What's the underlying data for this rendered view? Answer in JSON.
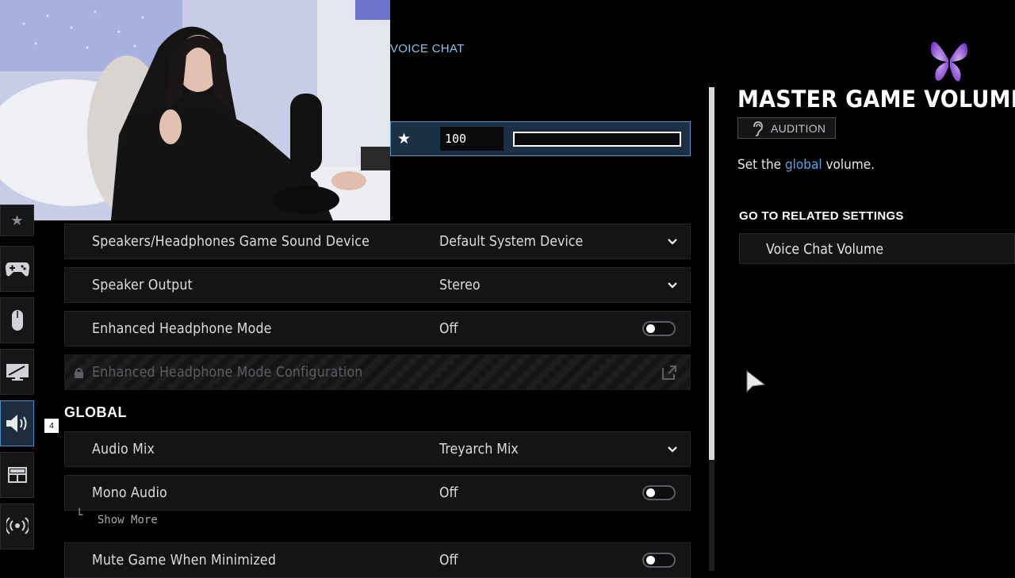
{
  "header": {
    "tab_label": "VOICE CHAT"
  },
  "volume_bar": {
    "value": "100",
    "level": 1.0
  },
  "nav": {
    "badge": "4"
  },
  "rows": [
    {
      "label": "Speakers/Headphones Game Sound Device",
      "value": "Default System Device"
    },
    {
      "label": "Speaker Output",
      "value": "Stereo"
    },
    {
      "label": "Enhanced Headphone Mode",
      "value": "Off"
    },
    {
      "label": "Enhanced Headphone Mode Configuration"
    }
  ],
  "global_section": {
    "title": "GLOBAL",
    "rows": [
      {
        "label": "Audio Mix",
        "value": "Treyarch Mix"
      },
      {
        "label": "Mono Audio",
        "value": "Off"
      },
      {
        "label": "Mute Game When Minimized",
        "value": "Off"
      }
    ],
    "show_more": "Show More"
  },
  "detail_panel": {
    "title": "MASTER GAME VOLUME",
    "audition_label": "AUDITION",
    "description_pre": "Set the ",
    "description_highlight": "global",
    "description_post": " volume.",
    "related_heading": "GO TO RELATED SETTINGS",
    "related_item": "Voice Chat Volume"
  },
  "colors": {
    "accent": "#48a9e6",
    "selected_row": "#1b3044",
    "active_nav_border": "#4a90c8",
    "butterfly": "#a45cf0"
  }
}
